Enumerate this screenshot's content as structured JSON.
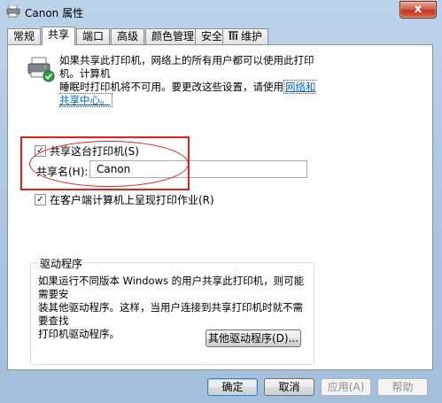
{
  "window": {
    "title": "Canon 属性",
    "close_label": "x"
  },
  "tabs": [
    {
      "label": "常规"
    },
    {
      "label": "共享"
    },
    {
      "label": "端口"
    },
    {
      "label": "高级"
    },
    {
      "label": "颜色管理"
    },
    {
      "label": "安全"
    },
    {
      "label": "维护",
      "icon": "maintenance-icon"
    }
  ],
  "active_tab": "共享",
  "share": {
    "info_line1": "如果共享此打印机，网络上的所有用户都可以使用此打印机。计算机",
    "info_line2": "睡眠时打印机将不可用。要更改这些设置，请使用",
    "network_link": "网络和共享中心。",
    "share_checkbox_label": "共享这台打印机(S)",
    "share_checked": true,
    "share_name_label": "共享名(H):",
    "share_name_value": "Canon",
    "render_jobs_label": "在客户端计算机上呈现打印作业(R)",
    "render_jobs_checked": true
  },
  "drivers": {
    "group_title": "驱动程序",
    "text_line1": "如果运行不同版本 Windows 的用户共享此打印机，则可能需要安",
    "text_line2": "装其他驱动程序。这样，当用户连接到共享打印机时就不需要查找",
    "text_line3": "打印机驱动程序。",
    "additional_drivers_button": "其他驱动程序(D)..."
  },
  "footer": {
    "ok": "确定",
    "cancel": "取消",
    "apply": "应用(A)",
    "help": "帮助"
  },
  "icons": {
    "window_icon": "printer-icon",
    "share_icon": "shared-printer-icon"
  },
  "colors": {
    "accent": "#0066cc",
    "highlight": "#e0201a",
    "window_chrome": "#bcd3ea"
  }
}
